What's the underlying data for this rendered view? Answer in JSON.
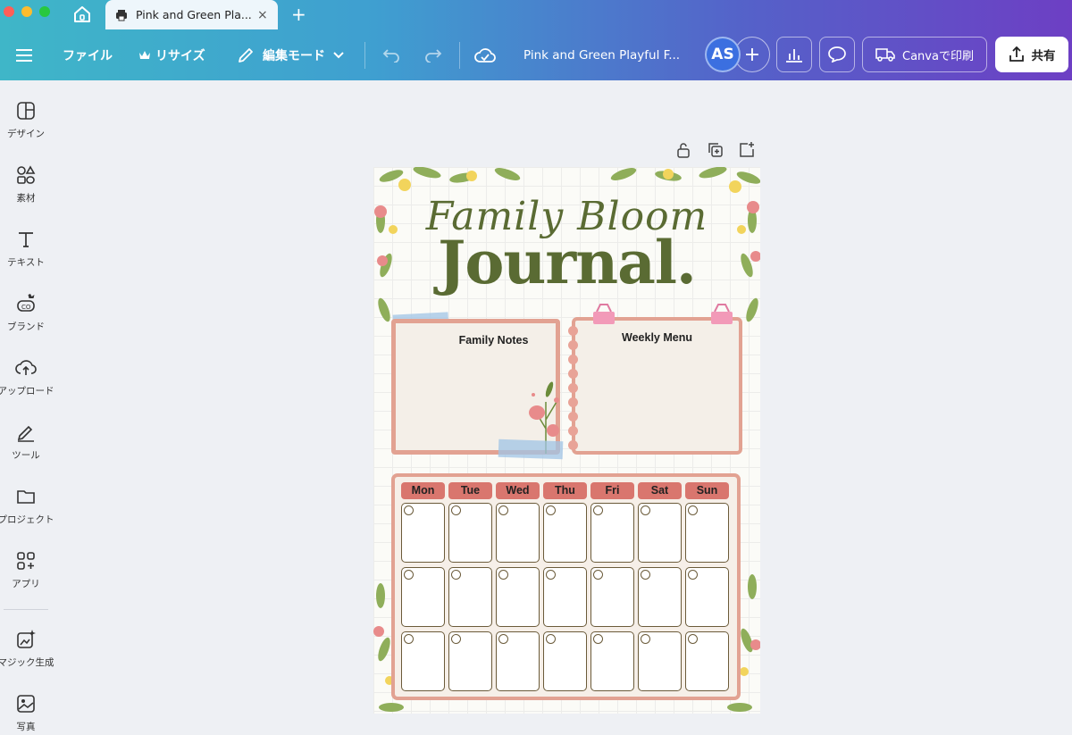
{
  "browser": {
    "tab_title": "Pink and Green Pla...",
    "tab_close": "×",
    "new_tab": "+"
  },
  "toolbar": {
    "file": "ファイル",
    "resize": "リサイズ",
    "edit_mode": "編集モード",
    "doc_title": "Pink and Green Playful F...",
    "avatar_initials": "AS",
    "add": "+",
    "print": "Canvaで印刷",
    "share": "共有"
  },
  "sidebar": {
    "items": [
      {
        "label": "デザイン",
        "icon": "design-icon"
      },
      {
        "label": "素材",
        "icon": "elements-icon"
      },
      {
        "label": "テキスト",
        "icon": "text-icon"
      },
      {
        "label": "ブランド",
        "icon": "brand-icon"
      },
      {
        "label": "アップロード",
        "icon": "upload-icon"
      },
      {
        "label": "ツール",
        "icon": "tools-icon"
      },
      {
        "label": "プロジェクト",
        "icon": "folder-icon"
      },
      {
        "label": "アプリ",
        "icon": "apps-icon"
      },
      {
        "label": "マジック生成",
        "icon": "magic-icon"
      },
      {
        "label": "写真",
        "icon": "photo-icon"
      }
    ]
  },
  "design": {
    "script_title": "Family Bloom",
    "main_title": "Journal.",
    "notes_title": "Family Notes",
    "menu_title": "Weekly Menu",
    "days": [
      "Mon",
      "Tue",
      "Wed",
      "Thu",
      "Fri",
      "Sat",
      "Sun"
    ],
    "weeks": 3
  },
  "colors": {
    "accent_olive": "#5a6b33",
    "card_border": "#e2a292",
    "day_header": "#d9766e",
    "avatar": "#3b6fe0"
  }
}
